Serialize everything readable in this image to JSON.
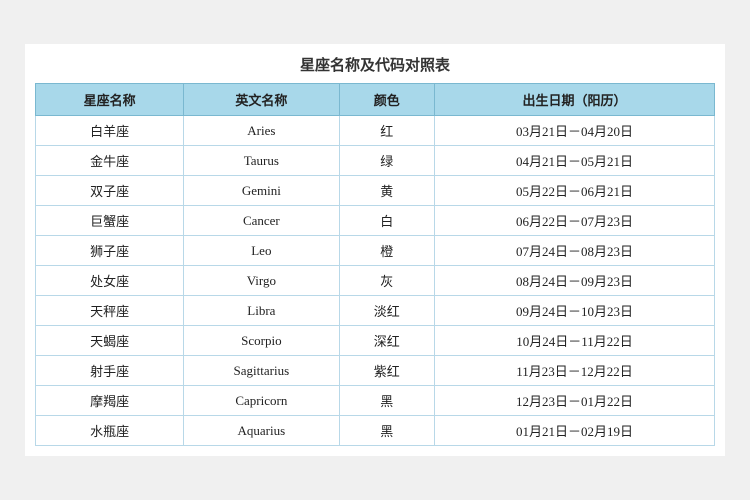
{
  "page": {
    "title": "星座名称及代码对照表"
  },
  "table": {
    "headers": [
      "星座名称",
      "英文名称",
      "颜色",
      "出生日期（阳历）"
    ],
    "rows": [
      [
        "白羊座",
        "Aries",
        "红",
        "03月21日－04月20日"
      ],
      [
        "金牛座",
        "Taurus",
        "绿",
        "04月21日－05月21日"
      ],
      [
        "双子座",
        "Gemini",
        "黄",
        "05月22日－06月21日"
      ],
      [
        "巨蟹座",
        "Cancer",
        "白",
        "06月22日－07月23日"
      ],
      [
        "狮子座",
        "Leo",
        "橙",
        "07月24日－08月23日"
      ],
      [
        "处女座",
        "Virgo",
        "灰",
        "08月24日－09月23日"
      ],
      [
        "天秤座",
        "Libra",
        "淡红",
        "09月24日－10月23日"
      ],
      [
        "天蝎座",
        "Scorpio",
        "深红",
        "10月24日－11月22日"
      ],
      [
        "射手座",
        "Sagittarius",
        "紫红",
        "11月23日－12月22日"
      ],
      [
        "摩羯座",
        "Capricorn",
        "黑",
        "12月23日－01月22日"
      ],
      [
        "水瓶座",
        "Aquarius",
        "黑",
        "01月21日－02月19日"
      ]
    ]
  }
}
